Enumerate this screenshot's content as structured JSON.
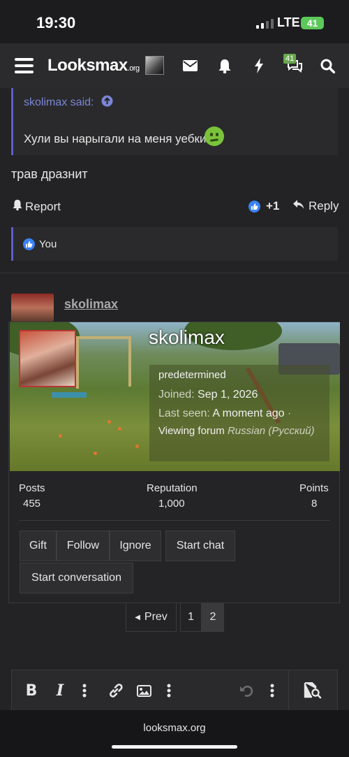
{
  "status": {
    "time": "19:30",
    "network": "LTE",
    "battery": "41"
  },
  "nav": {
    "logo_main": "Looksmax",
    "logo_suffix": ".org",
    "alerts_badge": "41",
    "icons": [
      "menu-icon",
      "envelope-icon",
      "bell-icon",
      "bolt-icon",
      "chat-bubbles-icon",
      "search-icon"
    ]
  },
  "quote": {
    "author": "skolimax said:",
    "text": "Хули вы нарыгали на меня уебки",
    "emoji": "nauseated-face-emoji"
  },
  "post": {
    "body": "трав дразнит",
    "report_label": "Report",
    "reaction_score": "+1",
    "reply_label": "Reply",
    "liked_by": "You"
  },
  "next_post": {
    "author": "skolimax"
  },
  "member_card": {
    "username": "skolimax",
    "title": "predetermined",
    "joined_label": "Joined:",
    "joined_value": "Sep 1, 2026",
    "last_seen_label": "Last seen:",
    "last_seen_value": "A moment ago",
    "activity_prefix": "Viewing forum",
    "activity_forum": "Russian (Русский)",
    "stats": [
      {
        "label": "Posts",
        "value": "455"
      },
      {
        "label": "Reputation",
        "value": "1,000"
      },
      {
        "label": "Points",
        "value": "8"
      }
    ],
    "buttons": {
      "gift": "Gift",
      "follow": "Follow",
      "ignore": "Ignore",
      "start_chat": "Start chat",
      "start_conversation": "Start conversation"
    }
  },
  "pagination": {
    "prev": "Prev",
    "pages": [
      "1",
      "2"
    ],
    "current": "2"
  },
  "editor": {
    "tools": [
      "bold-icon",
      "italic-icon",
      "more-vertical-icon",
      "link-icon",
      "image-icon",
      "more-vertical-icon",
      "undo-icon",
      "more-vertical-icon",
      "preview-icon"
    ],
    "bold": "B",
    "italic": "I"
  },
  "browser": {
    "url": "looksmax.org"
  },
  "colors": {
    "accent": "#5b5fc7",
    "link": "#7b86d6",
    "like": "#3b82f6",
    "badge": "#6aa84f",
    "battery": "#5cc85a"
  }
}
